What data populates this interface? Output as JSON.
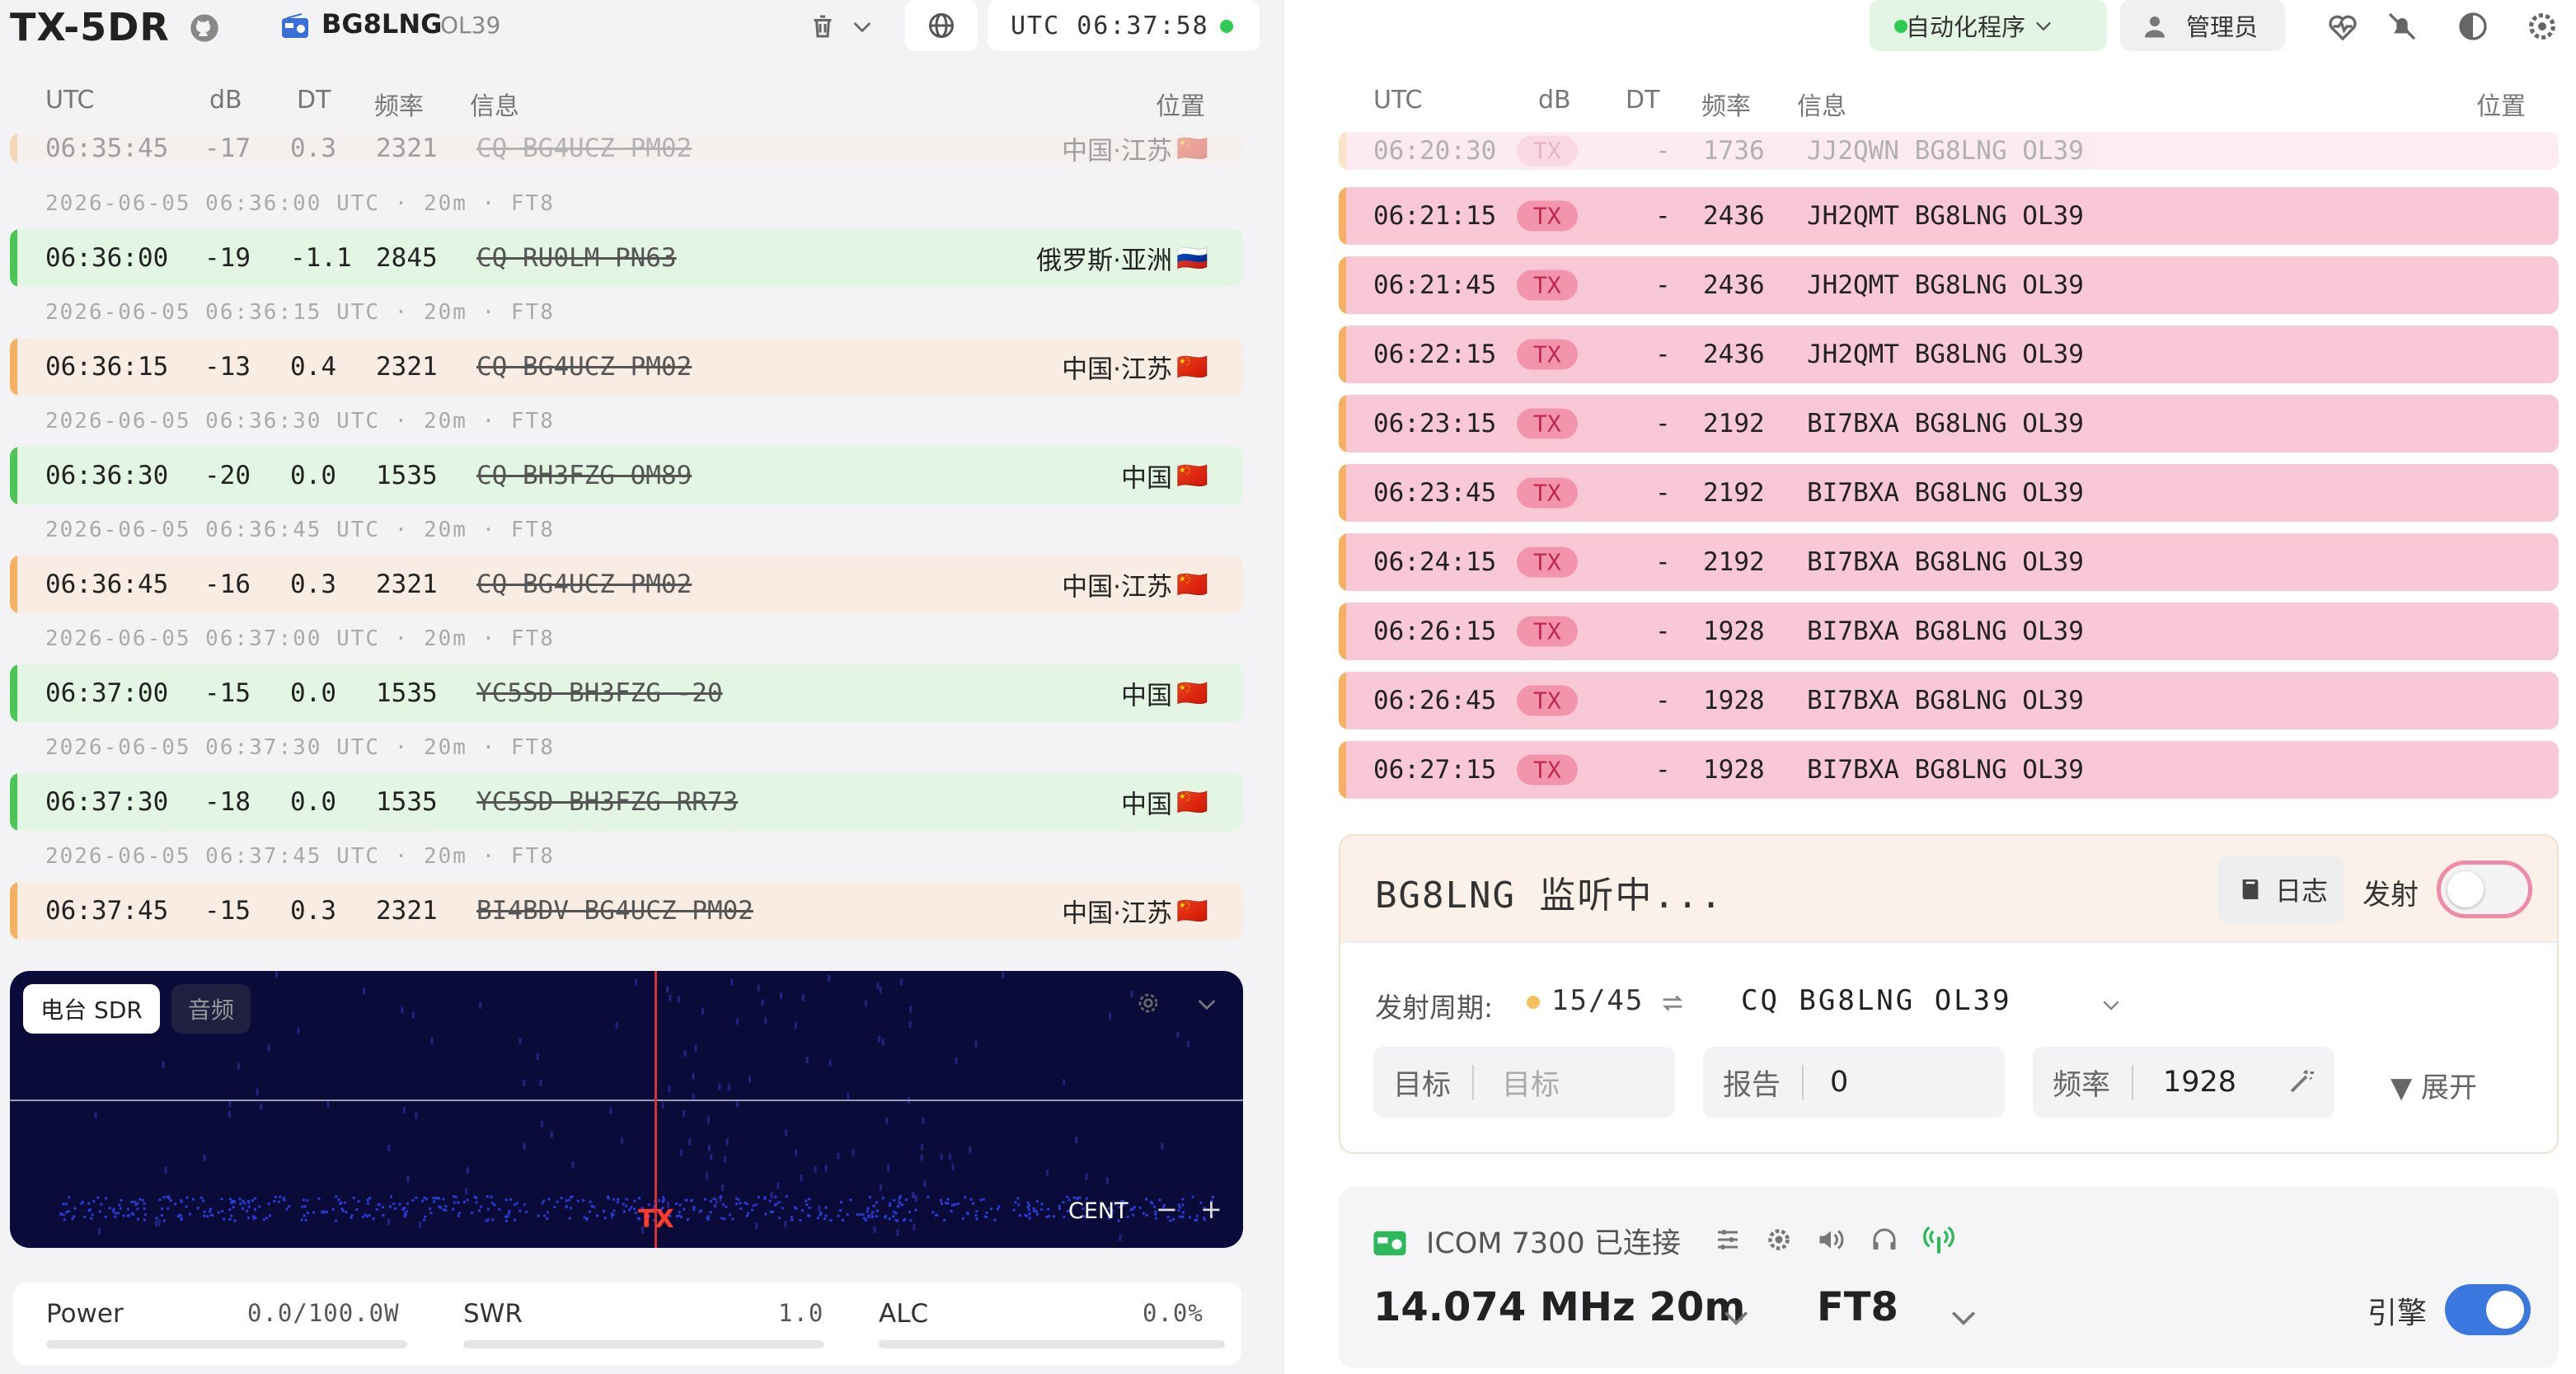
{
  "app": {
    "title": "TX-5DR",
    "callsign": "BG8LNG",
    "grid": "OL39",
    "utc_clock": "UTC 06:37:58"
  },
  "columns": {
    "utc": "UTC",
    "db": "dB",
    "dt": "DT",
    "freq": "频率",
    "info": "信息",
    "location": "位置"
  },
  "decodes": [
    {
      "kind": "row",
      "faded": true,
      "color": "peach",
      "utc": "06:35:45",
      "db": "-17",
      "dt": "0.3",
      "freq": "2321",
      "msg": "CQ BG4UCZ PM02",
      "loc": "中国·江苏",
      "flag": "🇨🇳"
    },
    {
      "kind": "sep",
      "text": "2026-06-05 06:36:00 UTC · 20m · FT8"
    },
    {
      "kind": "row",
      "color": "green",
      "utc": "06:36:00",
      "db": "-19",
      "dt": "-1.1",
      "freq": "2845",
      "msg": "CQ RU0LM PN63",
      "loc": "俄罗斯·亚洲",
      "flag": "🇷🇺"
    },
    {
      "kind": "sep",
      "text": "2026-06-05 06:36:15 UTC · 20m · FT8"
    },
    {
      "kind": "row",
      "color": "peach",
      "utc": "06:36:15",
      "db": "-13",
      "dt": "0.4",
      "freq": "2321",
      "msg": "CQ BG4UCZ PM02",
      "loc": "中国·江苏",
      "flag": "🇨🇳"
    },
    {
      "kind": "sep",
      "text": "2026-06-05 06:36:30 UTC · 20m · FT8"
    },
    {
      "kind": "row",
      "color": "green",
      "utc": "06:36:30",
      "db": "-20",
      "dt": "0.0",
      "freq": "1535",
      "msg": "CQ BH3FZG OM89",
      "loc": "中国",
      "flag": "🇨🇳"
    },
    {
      "kind": "sep",
      "text": "2026-06-05 06:36:45 UTC · 20m · FT8"
    },
    {
      "kind": "row",
      "color": "peach",
      "utc": "06:36:45",
      "db": "-16",
      "dt": "0.3",
      "freq": "2321",
      "msg": "CQ BG4UCZ PM02",
      "loc": "中国·江苏",
      "flag": "🇨🇳"
    },
    {
      "kind": "sep",
      "text": "2026-06-05 06:37:00 UTC · 20m · FT8"
    },
    {
      "kind": "row",
      "color": "green",
      "utc": "06:37:00",
      "db": "-15",
      "dt": "0.0",
      "freq": "1535",
      "msg": "YC5SD BH3FZG -20",
      "loc": "中国",
      "flag": "🇨🇳"
    },
    {
      "kind": "sep",
      "text": "2026-06-05 06:37:30 UTC · 20m · FT8"
    },
    {
      "kind": "row",
      "color": "green",
      "utc": "06:37:30",
      "db": "-18",
      "dt": "0.0",
      "freq": "1535",
      "msg": "YC5SD BH3FZG RR73",
      "loc": "中国",
      "flag": "🇨🇳"
    },
    {
      "kind": "sep",
      "text": "2026-06-05 06:37:45 UTC · 20m · FT8"
    },
    {
      "kind": "row",
      "color": "peach",
      "utc": "06:37:45",
      "db": "-15",
      "dt": "0.3",
      "freq": "2321",
      "msg": "BI4BDV BG4UCZ PM02",
      "loc": "中国·江苏",
      "flag": "🇨🇳"
    }
  ],
  "waterfall": {
    "tab_sdr": "电台 SDR",
    "tab_audio": "音频",
    "tx_marker": "TX",
    "cent": "CENT",
    "minus": "−",
    "plus": "+"
  },
  "meters": [
    {
      "label": "Power",
      "value": "0.0/100.0W"
    },
    {
      "label": "SWR",
      "value": "1.0"
    },
    {
      "label": "ALC",
      "value": "0.0%"
    }
  ],
  "header_right": {
    "automation": "自动化程序",
    "admin": "管理员"
  },
  "tx_log": [
    {
      "utc": "06:20:30",
      "badge": "TX",
      "db": "-",
      "freq": "1736",
      "msg": "JJ2QWN BG8LNG OL39",
      "faded": true
    },
    {
      "utc": "06:21:15",
      "badge": "TX",
      "db": "-",
      "freq": "2436",
      "msg": "JH2QMT BG8LNG OL39"
    },
    {
      "utc": "06:21:45",
      "badge": "TX",
      "db": "-",
      "freq": "2436",
      "msg": "JH2QMT BG8LNG OL39"
    },
    {
      "utc": "06:22:15",
      "badge": "TX",
      "db": "-",
      "freq": "2436",
      "msg": "JH2QMT BG8LNG OL39"
    },
    {
      "utc": "06:23:15",
      "badge": "TX",
      "db": "-",
      "freq": "2192",
      "msg": "BI7BXA BG8LNG OL39"
    },
    {
      "utc": "06:23:45",
      "badge": "TX",
      "db": "-",
      "freq": "2192",
      "msg": "BI7BXA BG8LNG OL39"
    },
    {
      "utc": "06:24:15",
      "badge": "TX",
      "db": "-",
      "freq": "2192",
      "msg": "BI7BXA BG8LNG OL39"
    },
    {
      "utc": "06:26:15",
      "badge": "TX",
      "db": "-",
      "freq": "1928",
      "msg": "BI7BXA BG8LNG OL39"
    },
    {
      "utc": "06:26:45",
      "badge": "TX",
      "db": "-",
      "freq": "1928",
      "msg": "BI7BXA BG8LNG OL39"
    },
    {
      "utc": "06:27:15",
      "badge": "TX",
      "db": "-",
      "freq": "1928",
      "msg": "BI7BXA BG8LNG OL39"
    }
  ],
  "panel": {
    "title": "BG8LNG 监听中...",
    "log_btn": "日志",
    "tx_label": "发射",
    "tx_enabled": false,
    "cycle_label": "发射周期:",
    "cycle_value": "15/45",
    "message": "CQ BG8LNG OL39",
    "target_label": "目标",
    "target_placeholder": "目标",
    "report_label": "报告",
    "report_value": "0",
    "freq_label": "频率",
    "freq_value": "1928",
    "expand": "▼ 展开"
  },
  "radio": {
    "status": "ICOM 7300 已连接",
    "frequency": "14.074 MHz 20m",
    "mode": "FT8",
    "engine_label": "引擎",
    "engine_on": true
  },
  "colors": {
    "green_row": "#e3f5e3",
    "peach_row": "#f9ece2",
    "pink_row": "#f9c8d6",
    "accent_blue": "#3a78e0",
    "tx_red": "#d83030"
  }
}
